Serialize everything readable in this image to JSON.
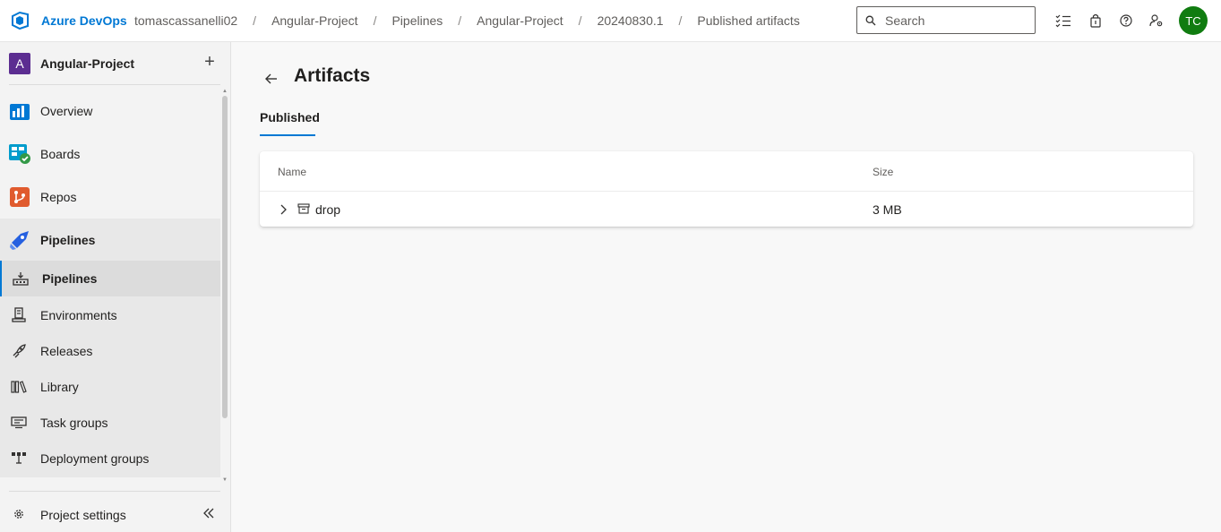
{
  "header": {
    "brand": "Azure DevOps",
    "breadcrumbs": [
      "tomascassanelli02",
      "Angular-Project",
      "Pipelines",
      "Angular-Project",
      "20240830.1",
      "Published artifacts"
    ],
    "search_placeholder": "Search",
    "avatar_initials": "TC",
    "avatar_color": "#107c10",
    "accent_color": "#0078d4"
  },
  "sidebar": {
    "project_initial": "A",
    "project_name": "Angular-Project",
    "project_badge_color": "#5c2d91",
    "items": [
      {
        "label": "Overview",
        "icon": "overview-icon"
      },
      {
        "label": "Boards",
        "icon": "boards-icon"
      },
      {
        "label": "Repos",
        "icon": "repos-icon"
      },
      {
        "label": "Pipelines",
        "icon": "pipelines-icon"
      }
    ],
    "sub_items": [
      {
        "label": "Pipelines",
        "icon": "pipelines-sub-icon"
      },
      {
        "label": "Environments",
        "icon": "environments-icon"
      },
      {
        "label": "Releases",
        "icon": "releases-icon"
      },
      {
        "label": "Library",
        "icon": "library-icon"
      },
      {
        "label": "Task groups",
        "icon": "task-groups-icon"
      },
      {
        "label": "Deployment groups",
        "icon": "deployment-groups-icon"
      }
    ],
    "settings_label": "Project settings"
  },
  "main": {
    "title": "Artifacts",
    "tab": "Published",
    "table": {
      "columns": [
        "Name",
        "Size"
      ],
      "rows": [
        {
          "name": "drop",
          "size": "3 MB"
        }
      ]
    }
  }
}
